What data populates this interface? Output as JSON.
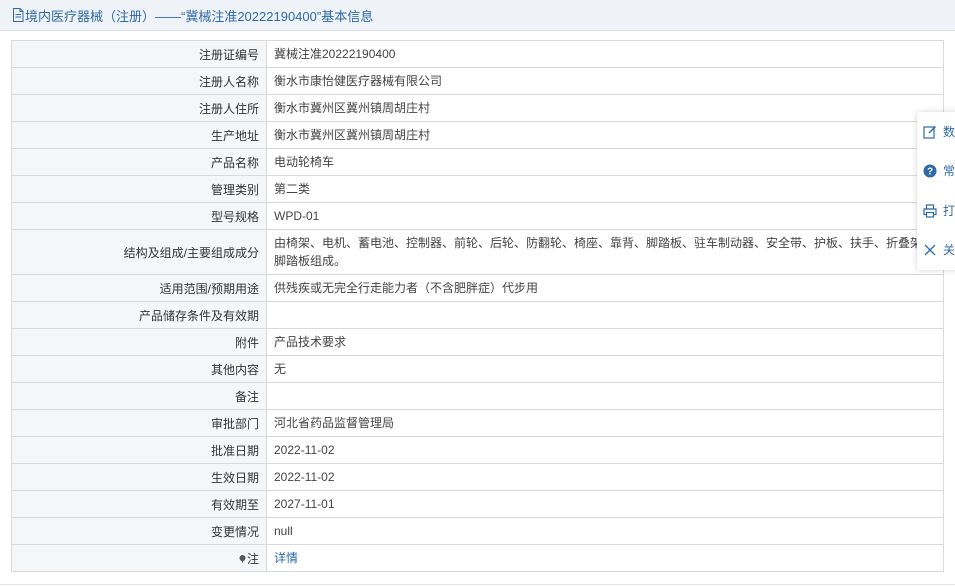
{
  "header": {
    "title": "境内医疗器械（注册）——“冀械注准20222190400”基本信息",
    "icon": "document-icon"
  },
  "rows": [
    {
      "label": "注册证编号",
      "value": "冀械注准20222190400"
    },
    {
      "label": "注册人名称",
      "value": "衡水市康怡健医疗器械有限公司"
    },
    {
      "label": "注册人住所",
      "value": "衡水市冀州区冀州镇周胡庄村"
    },
    {
      "label": "生产地址",
      "value": "衡水市冀州区冀州镇周胡庄村"
    },
    {
      "label": "产品名称",
      "value": "电动轮椅车"
    },
    {
      "label": "管理类别",
      "value": "第二类"
    },
    {
      "label": "型号规格",
      "value": "WPD-01"
    },
    {
      "label": "结构及组成/主要组成成分",
      "value": "由椅架、电机、蓄电池、控制器、前轮、后轮、防翻轮、椅座、靠背、脚踏板、驻车制动器、安全带、护板、扶手、折叠架、脚踏板组成。"
    },
    {
      "label": "适用范围/预期用途",
      "value": "供残疾或无完全行走能力者（不含肥胖症）代步用"
    },
    {
      "label": "产品储存条件及有效期",
      "value": ""
    },
    {
      "label": "附件",
      "value": "产品技术要求"
    },
    {
      "label": "其他内容",
      "value": "无"
    },
    {
      "label": "备注",
      "value": ""
    },
    {
      "label": "审批部门",
      "value": "河北省药品监督管理局"
    },
    {
      "label": "批准日期",
      "value": "2022-11-02"
    },
    {
      "label": "生效日期",
      "value": "2022-11-02"
    },
    {
      "label": "有效期至",
      "value": "2027-11-01"
    },
    {
      "label": "变更情况",
      "value": "null"
    }
  ],
  "note_row": {
    "label": "注",
    "link": "详情",
    "icon": "pin-icon"
  },
  "float_menu": [
    {
      "label": "数",
      "icon": "edit-icon"
    },
    {
      "label": "常",
      "icon": "help-icon"
    },
    {
      "label": "打",
      "icon": "print-icon"
    },
    {
      "label": "关",
      "icon": "close-icon"
    }
  ],
  "colors": {
    "accent": "#2d6aa8",
    "label_bg": "#f5f6f8",
    "header_bg": "#eff2f6",
    "border": "#d9d9d9"
  }
}
